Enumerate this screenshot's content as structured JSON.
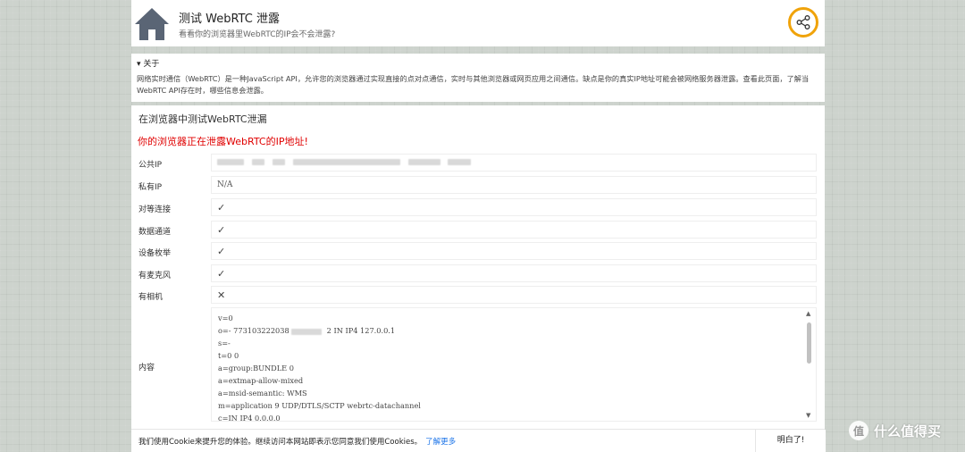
{
  "header": {
    "title": "测试 WebRTC 泄露",
    "subtitle": "看看你的浏览器里WebRTC的IP会不会泄露?",
    "home_icon": "home-icon",
    "share_icon": "share-icon",
    "accent_color": "#f0a30a"
  },
  "about": {
    "summary": "▾ 关于",
    "text": "网络实时通信（WebRTC）是一种JavaScript API，允许您的浏览器通过实现直接的点对点通信，实时与其他浏览器或网页应用之间通信。缺点是你的真实IP地址可能会被网络服务器泄露。查看此页面，了解当WebRTC API存在时，哪些信息会泄露。"
  },
  "test": {
    "title": "在浏览器中测试WebRTC泄漏",
    "warning": "你的浏览器正在泄露WebRTC的IP地址!",
    "rows": [
      {
        "label": "公共IP",
        "value": ""
      },
      {
        "label": "私有IP",
        "value": "N/A"
      },
      {
        "label": "对等连接",
        "value": "✓"
      },
      {
        "label": "数据通道",
        "value": "✓"
      },
      {
        "label": "设备枚举",
        "value": "✓"
      },
      {
        "label": "有麦克风",
        "value": "✓"
      },
      {
        "label": "有相机",
        "value": "✕"
      }
    ],
    "content_label": "内容",
    "content_lines": [
      "v=0",
      "o=- 773103222038",
      "s=-",
      "t=0 0",
      "a=group:BUNDLE 0",
      "a=extmap-allow-mixed",
      "a=msid-semantic: WMS",
      "m=application 9 UDP/DTLS/SCTP webrtc-datachannel",
      "c=IN IP4 0.0.0.0"
    ],
    "content_line2_suffix": "2 IN IP4 127.0.0.1"
  },
  "cookie": {
    "text": "我们使用Cookie来提升您的体验。继续访问本网站即表示您同意我们使用Cookies。",
    "link": "了解更多",
    "button": "明白了!"
  },
  "watermark": {
    "glyph": "值",
    "text": "什么值得买"
  }
}
